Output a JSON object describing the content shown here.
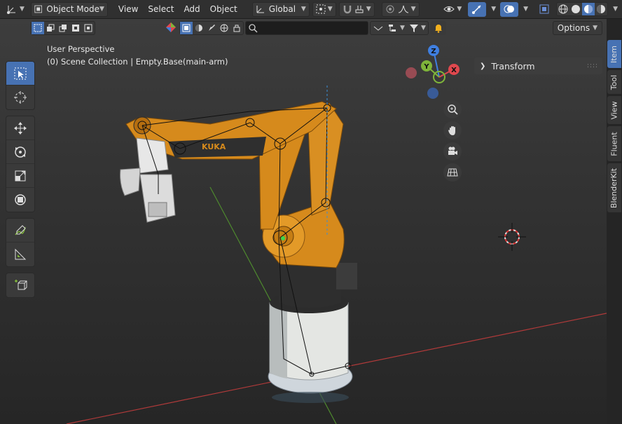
{
  "header": {
    "mode_label": "Object Mode",
    "menus": [
      "View",
      "Select",
      "Add",
      "Object"
    ],
    "orientation_label": "Global"
  },
  "toolbar2": {
    "options_label": "Options"
  },
  "viewport": {
    "perspective_label": "User Perspective",
    "collection_label": "(0) Scene Collection | Empty.Base(main-arm)",
    "robot_brand_text": "KUKA",
    "gizmo": {
      "z": "Z",
      "y": "Y",
      "x": "X"
    }
  },
  "tools": [
    "select-box",
    "cursor",
    "move",
    "rotate",
    "scale",
    "transform",
    "annotate",
    "measure",
    "add-cube"
  ],
  "sidebar": {
    "panel_title": "Transform",
    "tabs": [
      "Item",
      "Tool",
      "View",
      "Fluent",
      "BlenderKit"
    ],
    "active_tab": "Item"
  },
  "colors": {
    "accent": "#4772b3",
    "robot_orange": "#d68a1c",
    "axis_x": "#e0484e",
    "axis_y": "#7fb53a",
    "axis_z": "#3f7fe0"
  }
}
